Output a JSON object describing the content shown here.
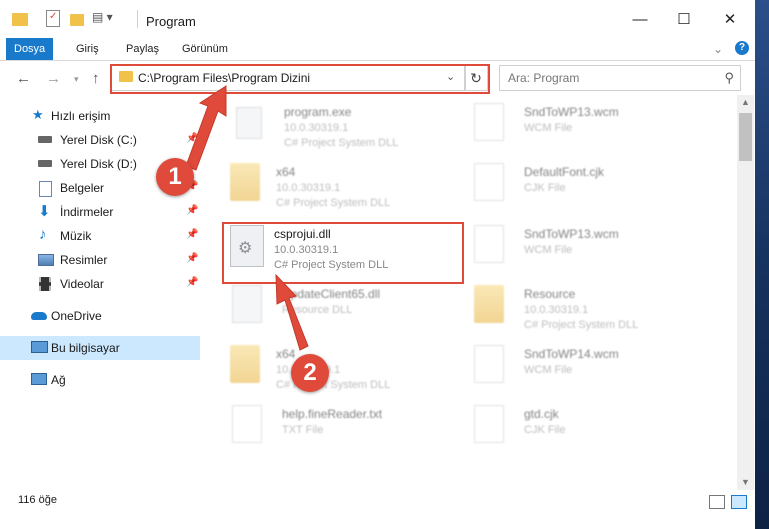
{
  "window": {
    "title": "Program"
  },
  "ribbon": {
    "tabs": [
      "Dosya",
      "Giriş",
      "Paylaş",
      "Görünüm"
    ]
  },
  "address": {
    "path": "C:\\Program Files\\Program Dizini"
  },
  "search": {
    "placeholder": "Ara: Program"
  },
  "sidebar": {
    "items": [
      {
        "label": "Hızlı erişim",
        "icon": "star-icon"
      },
      {
        "label": "Yerel Disk (C:)",
        "icon": "drive-icon"
      },
      {
        "label": "Yerel Disk (D:)",
        "icon": "drive-icon"
      },
      {
        "label": "Belgeler",
        "icon": "documents-icon"
      },
      {
        "label": "İndirmeler",
        "icon": "download-icon"
      },
      {
        "label": "Müzik",
        "icon": "music-icon"
      },
      {
        "label": "Resimler",
        "icon": "pictures-icon"
      },
      {
        "label": "Videolar",
        "icon": "video-icon"
      },
      {
        "label": "OneDrive",
        "icon": "cloud-icon"
      },
      {
        "label": "Bu bilgisayar",
        "icon": "computer-icon"
      },
      {
        "label": "Ağ",
        "icon": "network-icon"
      }
    ]
  },
  "files": {
    "left": [
      {
        "name": "program.exe",
        "meta1": "10.0.30319.1",
        "meta2": "C# Project System DLL"
      },
      {
        "name": "x64",
        "meta1": "10.0.30319.1",
        "meta2": "C# Project System DLL"
      },
      {
        "name": "csprojui.dll",
        "meta1": "10.0.30319.1",
        "meta2": "C# Project System DLL"
      },
      {
        "name": "UpdateClient65.dll",
        "meta1": "",
        "meta2": "Resource DLL"
      },
      {
        "name": "x64",
        "meta1": "10.0.30319.1",
        "meta2": "C# Project System DLL"
      },
      {
        "name": "help.fineReader.txt",
        "meta1": "",
        "meta2": "TXT File"
      }
    ],
    "right": [
      {
        "name": "SndToWP13.wcm",
        "meta1": "WCM File",
        "meta2": ""
      },
      {
        "name": "DefaultFont.cjk",
        "meta1": "CJK File",
        "meta2": ""
      },
      {
        "name": "SndToWP13.wcm",
        "meta1": "WCM File",
        "meta2": ""
      },
      {
        "name": "Resource",
        "meta1": "10.0.30319.1",
        "meta2": "C# Project System DLL"
      },
      {
        "name": "SndToWP14.wcm",
        "meta1": "WCM File",
        "meta2": ""
      },
      {
        "name": "gtd.cjk",
        "meta1": "CJK File",
        "meta2": ""
      }
    ]
  },
  "status": {
    "count": "116 öğe"
  },
  "annotations": {
    "badge1": "1",
    "badge2": "2"
  },
  "colors": {
    "accent": "#1979ca",
    "annotation": "#e04a3a",
    "selected": "#cce8ff"
  }
}
